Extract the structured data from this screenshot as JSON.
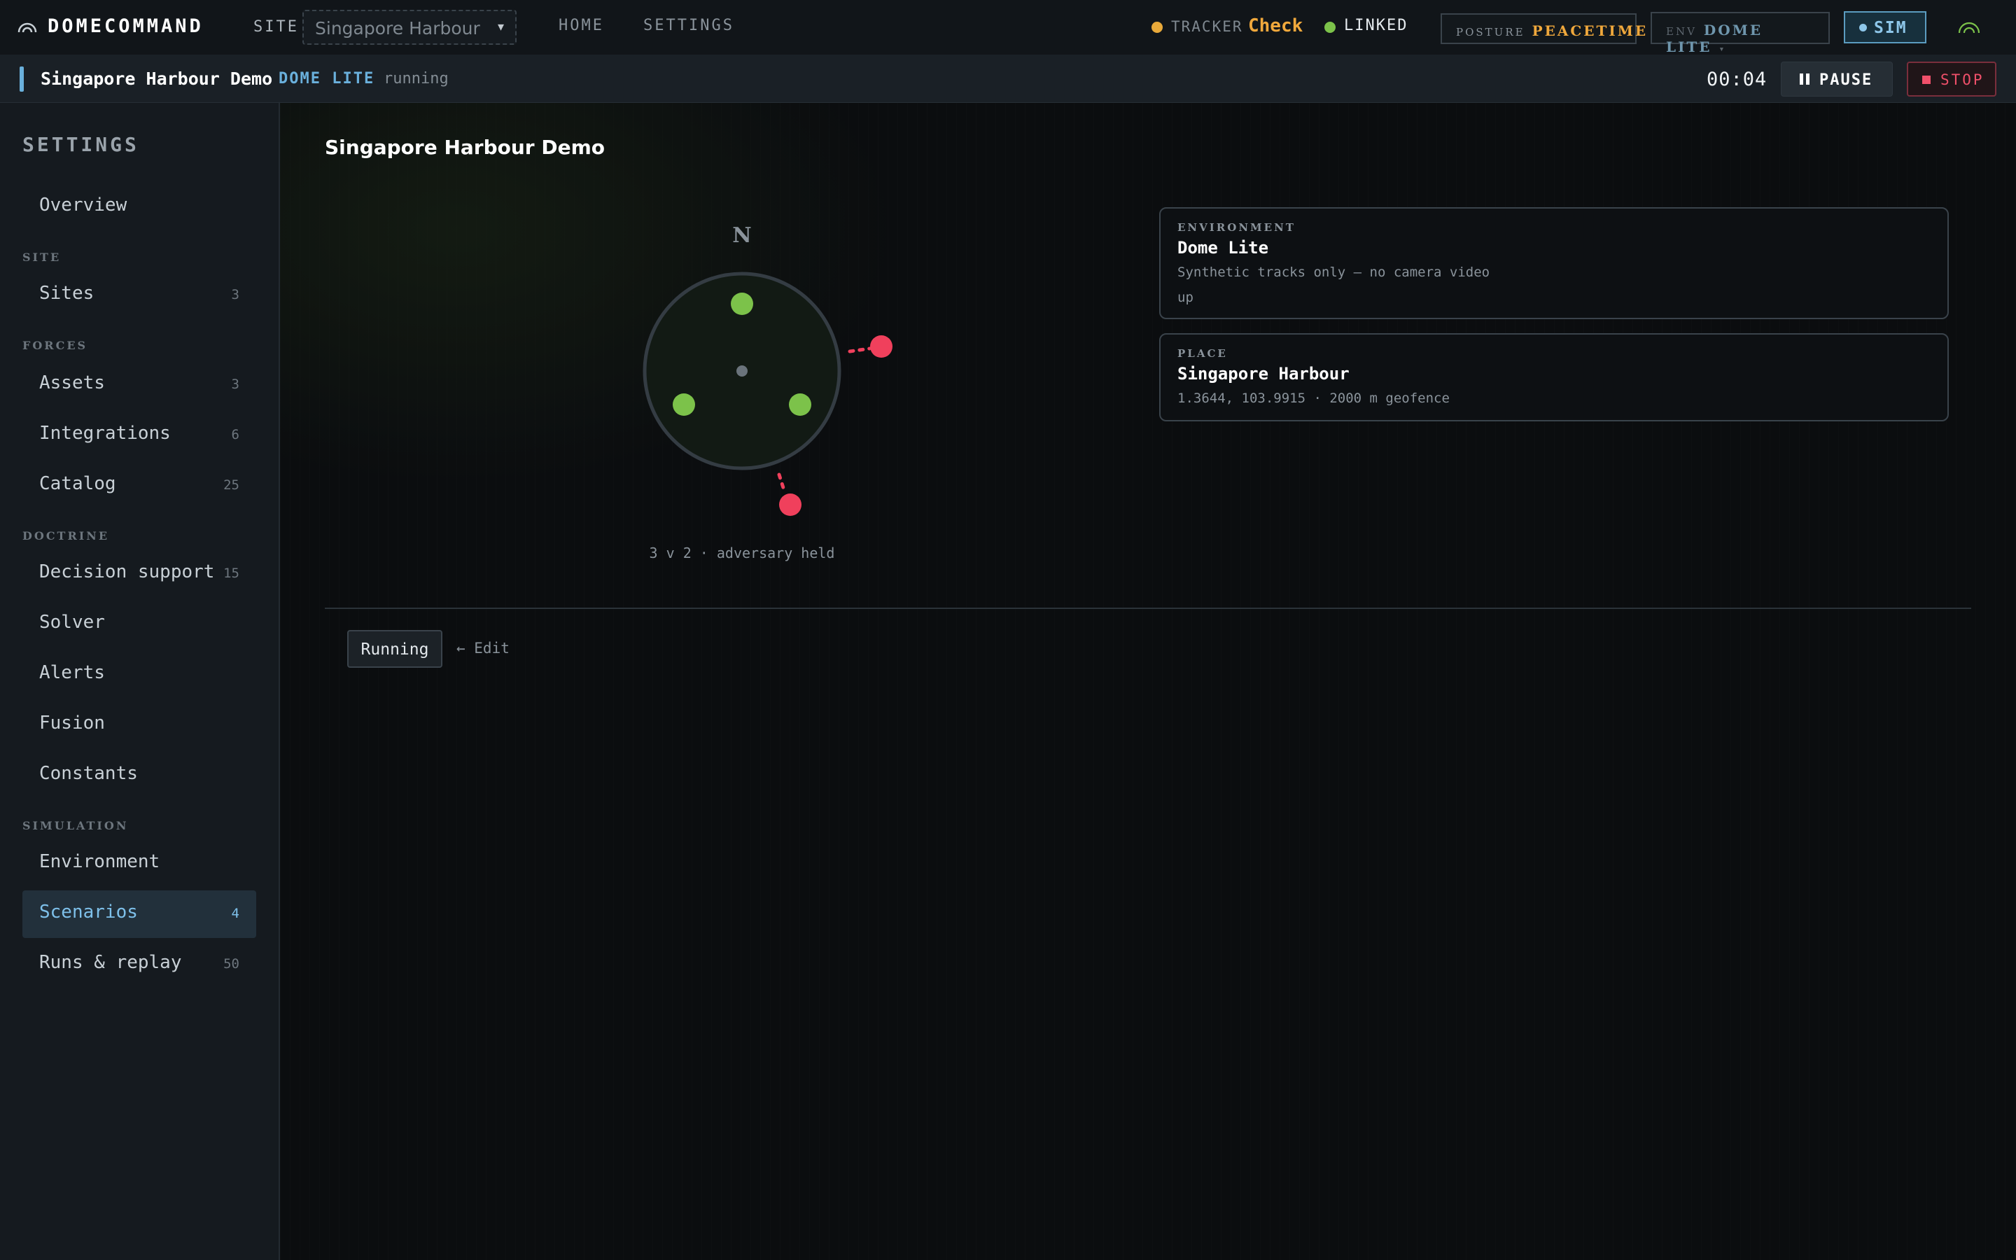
{
  "app": {
    "brand": "DOMECOMMAND",
    "site_label": "SITE",
    "site_value": "Singapore Harbour",
    "nav": {
      "home": "HOME",
      "settings": "SETTINGS"
    },
    "tracker": {
      "label": "TRACKER",
      "value": "Check",
      "dot_color": "#e8a93a"
    },
    "link": {
      "label": "LINKED",
      "dot_color": "#7cc24a"
    },
    "posture": {
      "label": "POSTURE",
      "value": "PEACETIME"
    },
    "env": {
      "label": "ENV",
      "value": "DOME LITE"
    },
    "sim_label": "SIM",
    "icons": [
      "dome-logo-icon",
      "chevron-down-icon",
      "signal-arc-icon"
    ]
  },
  "run_bar": {
    "title": "Singapore Harbour Demo",
    "env": "DOME LITE",
    "state": "running",
    "timer": "00:04",
    "pause_label": "PAUSE",
    "stop_label": "STOP"
  },
  "sidebar": {
    "title": "SETTINGS",
    "overview": "Overview",
    "groups": {
      "site": "SITE",
      "forces": "FORCES",
      "doctrine": "DOCTRINE",
      "simulation": "SIMULATION"
    },
    "items": {
      "sites": {
        "label": "Sites",
        "count": "3"
      },
      "assets": {
        "label": "Assets",
        "count": "3"
      },
      "integrations": {
        "label": "Integrations",
        "count": "6"
      },
      "catalog": {
        "label": "Catalog",
        "count": "25"
      },
      "decision_support": {
        "label": "Decision support",
        "count": "15"
      },
      "solver": {
        "label": "Solver"
      },
      "alerts": {
        "label": "Alerts"
      },
      "fusion": {
        "label": "Fusion"
      },
      "constants": {
        "label": "Constants"
      },
      "environment": {
        "label": "Environment"
      },
      "scenarios": {
        "label": "Scenarios",
        "count": "4"
      },
      "runs_replay": {
        "label": "Runs & replay",
        "count": "50"
      }
    },
    "active_item": "scenarios"
  },
  "main": {
    "title": "Singapore Harbour Demo",
    "radar": {
      "north_label": "N",
      "caption": "3 v 2 · adversary held",
      "friendly_color": "#7cc24a",
      "hostile_color": "#f0405c"
    },
    "environment_card": {
      "label": "ENVIRONMENT",
      "title": "Dome Lite",
      "description": "Synthetic tracks only — no camera video",
      "status": "up"
    },
    "place_card": {
      "label": "PLACE",
      "title": "Singapore Harbour",
      "details": "1.3644, 103.9915 · 2000 m geofence"
    },
    "running_label": "Running",
    "edit_label": "← Edit"
  }
}
